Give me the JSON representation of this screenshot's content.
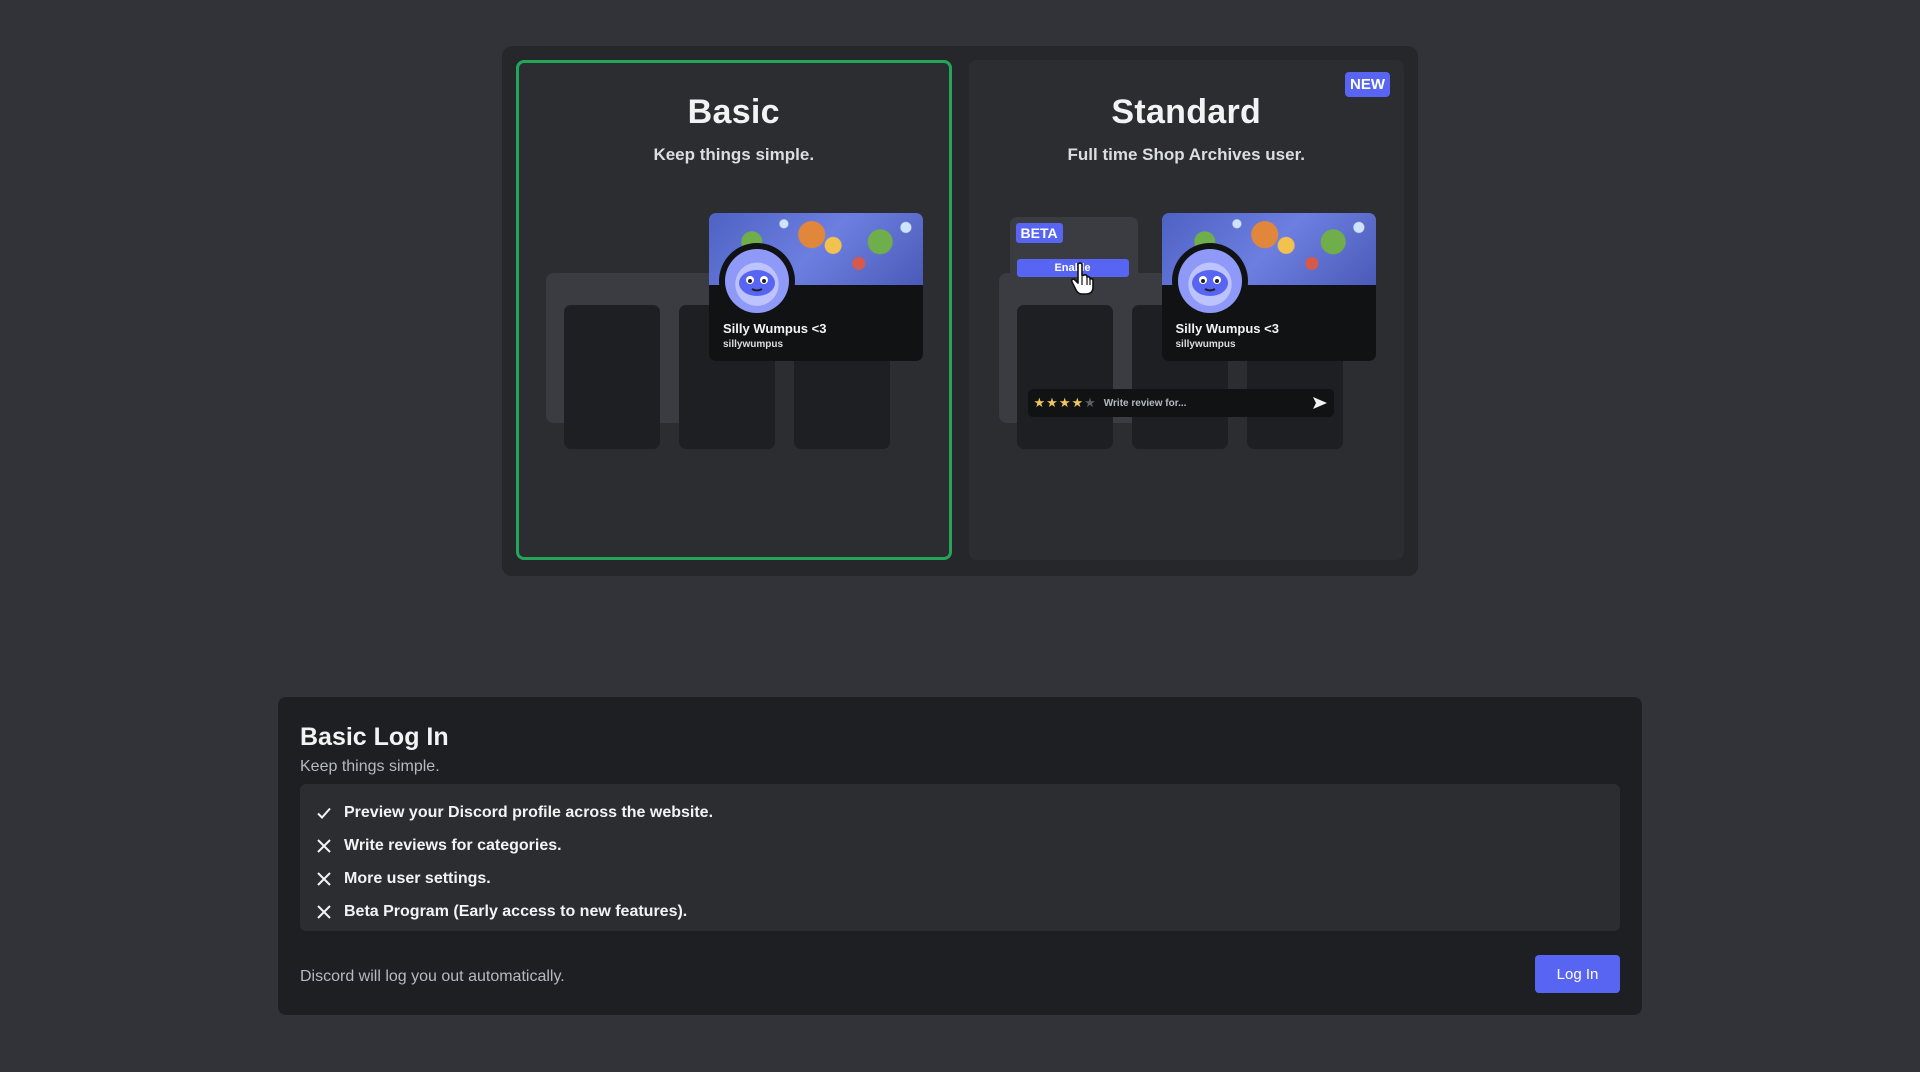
{
  "plans": {
    "basic": {
      "title": "Basic",
      "subtitle": "Keep things simple.",
      "selected": true
    },
    "standard": {
      "title": "Standard",
      "subtitle": "Full time Shop Archives user.",
      "badge": "NEW",
      "beta_tag": "BETA",
      "enable_label": "Enable",
      "review_placeholder": "Write review for...",
      "stars_filled": 4,
      "stars_total": 5
    },
    "profile": {
      "display_name": "Silly Wumpus <3",
      "username": "sillywumpus"
    }
  },
  "login": {
    "title": "Basic Log In",
    "subtitle": "Keep things simple.",
    "features": [
      {
        "text": "Preview your Discord profile across the website.",
        "icon": "check-icon",
        "included": true
      },
      {
        "text": "Write reviews for categories.",
        "icon": "x-icon",
        "included": false
      },
      {
        "text": "More user settings.",
        "icon": "x-icon",
        "included": false
      },
      {
        "text": "Beta Program (Early access to new features).",
        "icon": "x-icon",
        "included": false
      }
    ],
    "footer_note": "Discord will log you out automatically.",
    "button_label": "Log In"
  },
  "colors": {
    "accent": "#5865f2",
    "selected_border": "#23a55a",
    "background": "#313338",
    "card": "#1e1f22"
  }
}
